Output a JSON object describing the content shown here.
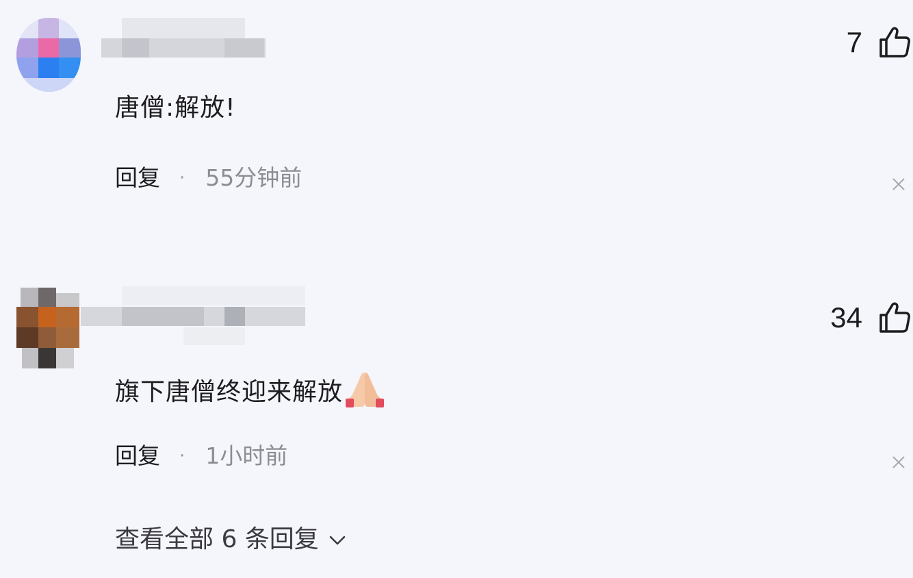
{
  "comments": [
    {
      "text": "唐僧:解放!",
      "reply_label": "回复",
      "separator": "·",
      "time": "55分钟前",
      "likes": "7"
    },
    {
      "text": "旗下唐僧终迎来解放",
      "emoji_icon": "folded-hands-icon",
      "reply_label": "回复",
      "separator": "·",
      "time": "1小时前",
      "likes": "34"
    }
  ],
  "view_all": {
    "label": "查看全部 6 条回复"
  },
  "colors": {
    "background": "#f5f6fb",
    "text": "#1d1d1f",
    "muted": "#8c8c94"
  }
}
